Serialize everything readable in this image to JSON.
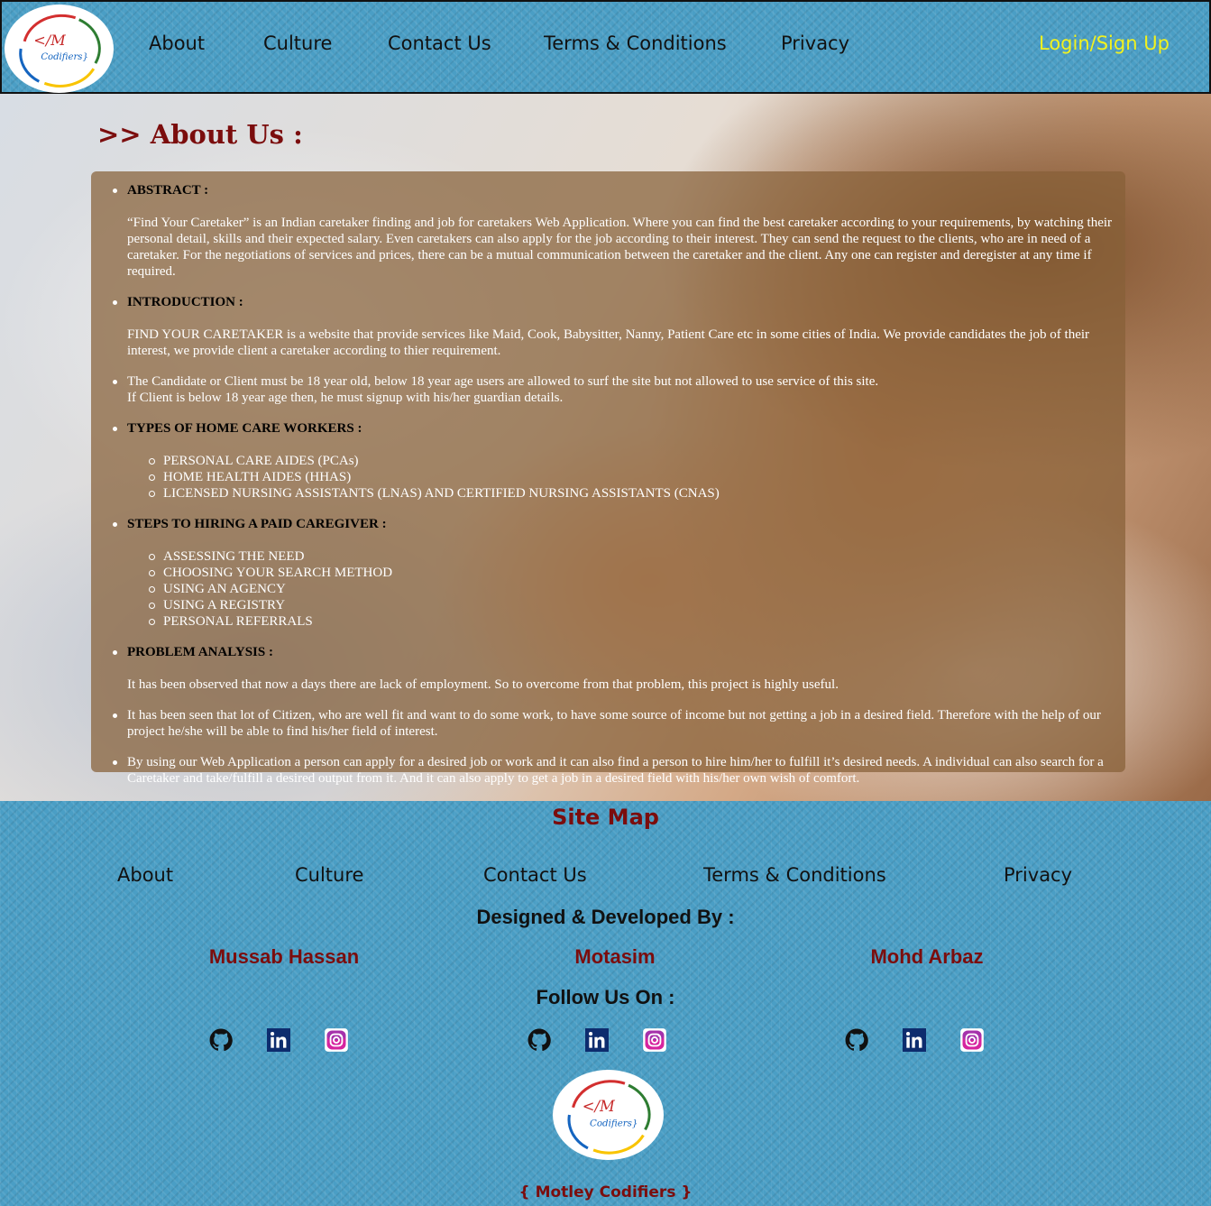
{
  "header": {
    "nav": [
      "About",
      "Culture",
      "Contact Us",
      "Terms & Conditions",
      "Privacy"
    ],
    "login": "Login/Sign Up"
  },
  "logo": {
    "mark": "</M",
    "text": "Codifiers}"
  },
  "page_title": ">> About Us :",
  "content": {
    "abstract_heading": "ABSTRACT :",
    "abstract_text": "“Find Your Caretaker” is an Indian caretaker finding and job for caretakers Web Application. Where you can find the best caretaker according to your requirements, by watching their personal detail, skills and their expected salary. Even caretakers can also apply for the job according to their interest. They can send the request to the clients, who are in need of a caretaker. For the negotiations of services and prices, there can be a mutual communication between the caretaker and the client. Any one can register and deregister at any time if required.",
    "intro_heading": "INTRODUCTION :",
    "intro_text": "FIND YOUR CARETAKER is a website that provide services like Maid, Cook, Babysitter, Nanny, Patient Care etc in some cities of India. We provide candidates the job of their interest, we provide client a caretaker according to thier requirement.",
    "age_line1": "The Candidate or Client must be 18 year old, below 18 year age users are allowed to surf the site but not allowed to use service of this site.",
    "age_line2": "If Client is below 18 year age then, he must signup with his/her guardian details.",
    "types_heading": "TYPES OF HOME CARE WORKERS :",
    "types": [
      "PERSONAL CARE AIDES (PCAs)",
      "HOME HEALTH AIDES (HHAS)",
      "LICENSED NURSING ASSISTANTS (LNAS) AND CERTIFIED NURSING ASSISTANTS (CNAS)"
    ],
    "steps_heading": "STEPS TO HIRING A PAID CAREGIVER :",
    "steps": [
      "ASSESSING THE NEED",
      "CHOOSING YOUR SEARCH METHOD",
      "USING AN AGENCY",
      "USING A REGISTRY",
      "PERSONAL REFERRALS"
    ],
    "problem_heading": "PROBLEM ANALYSIS :",
    "problem_text": "It has been observed that now a days there are lack of employment. So to overcome from that problem, this project is highly useful.",
    "citizen_text": "It has been seen that lot of Citizen, who are well fit and want to do some work, to have some source of income but not getting a job in a desired field. Therefore with the help of our project he/she will be able to find his/her field of interest.",
    "webapp_text": "By using our Web Application a person can apply for a desired job or work and it can also find a person to hire him/her to fulfill it’s desired needs. A individual can also search for a Caretaker and take/fulfill a desired output from it. And it can also apply to get a job in a desired field with his/her own wish of comfort."
  },
  "footer": {
    "sitemap_title": "Site Map",
    "links": [
      "About",
      "Culture",
      "Contact Us",
      "Terms & Conditions",
      "Privacy"
    ],
    "designed_title": "Designed & Developed By :",
    "developers": [
      "Mussab Hassan",
      "Motasim",
      "Mohd Arbaz"
    ],
    "follow_title": "Follow Us On :",
    "social_icons": [
      "github-icon",
      "linkedin-icon",
      "instagram-icon"
    ],
    "brand": "{ Motley Codifiers }"
  },
  "colors": {
    "accent_dark_red": "#7b0d0d",
    "login_yellow": "#f2f21e",
    "texture_blue": "#4a9ec5",
    "panel_brown": "#876037"
  }
}
